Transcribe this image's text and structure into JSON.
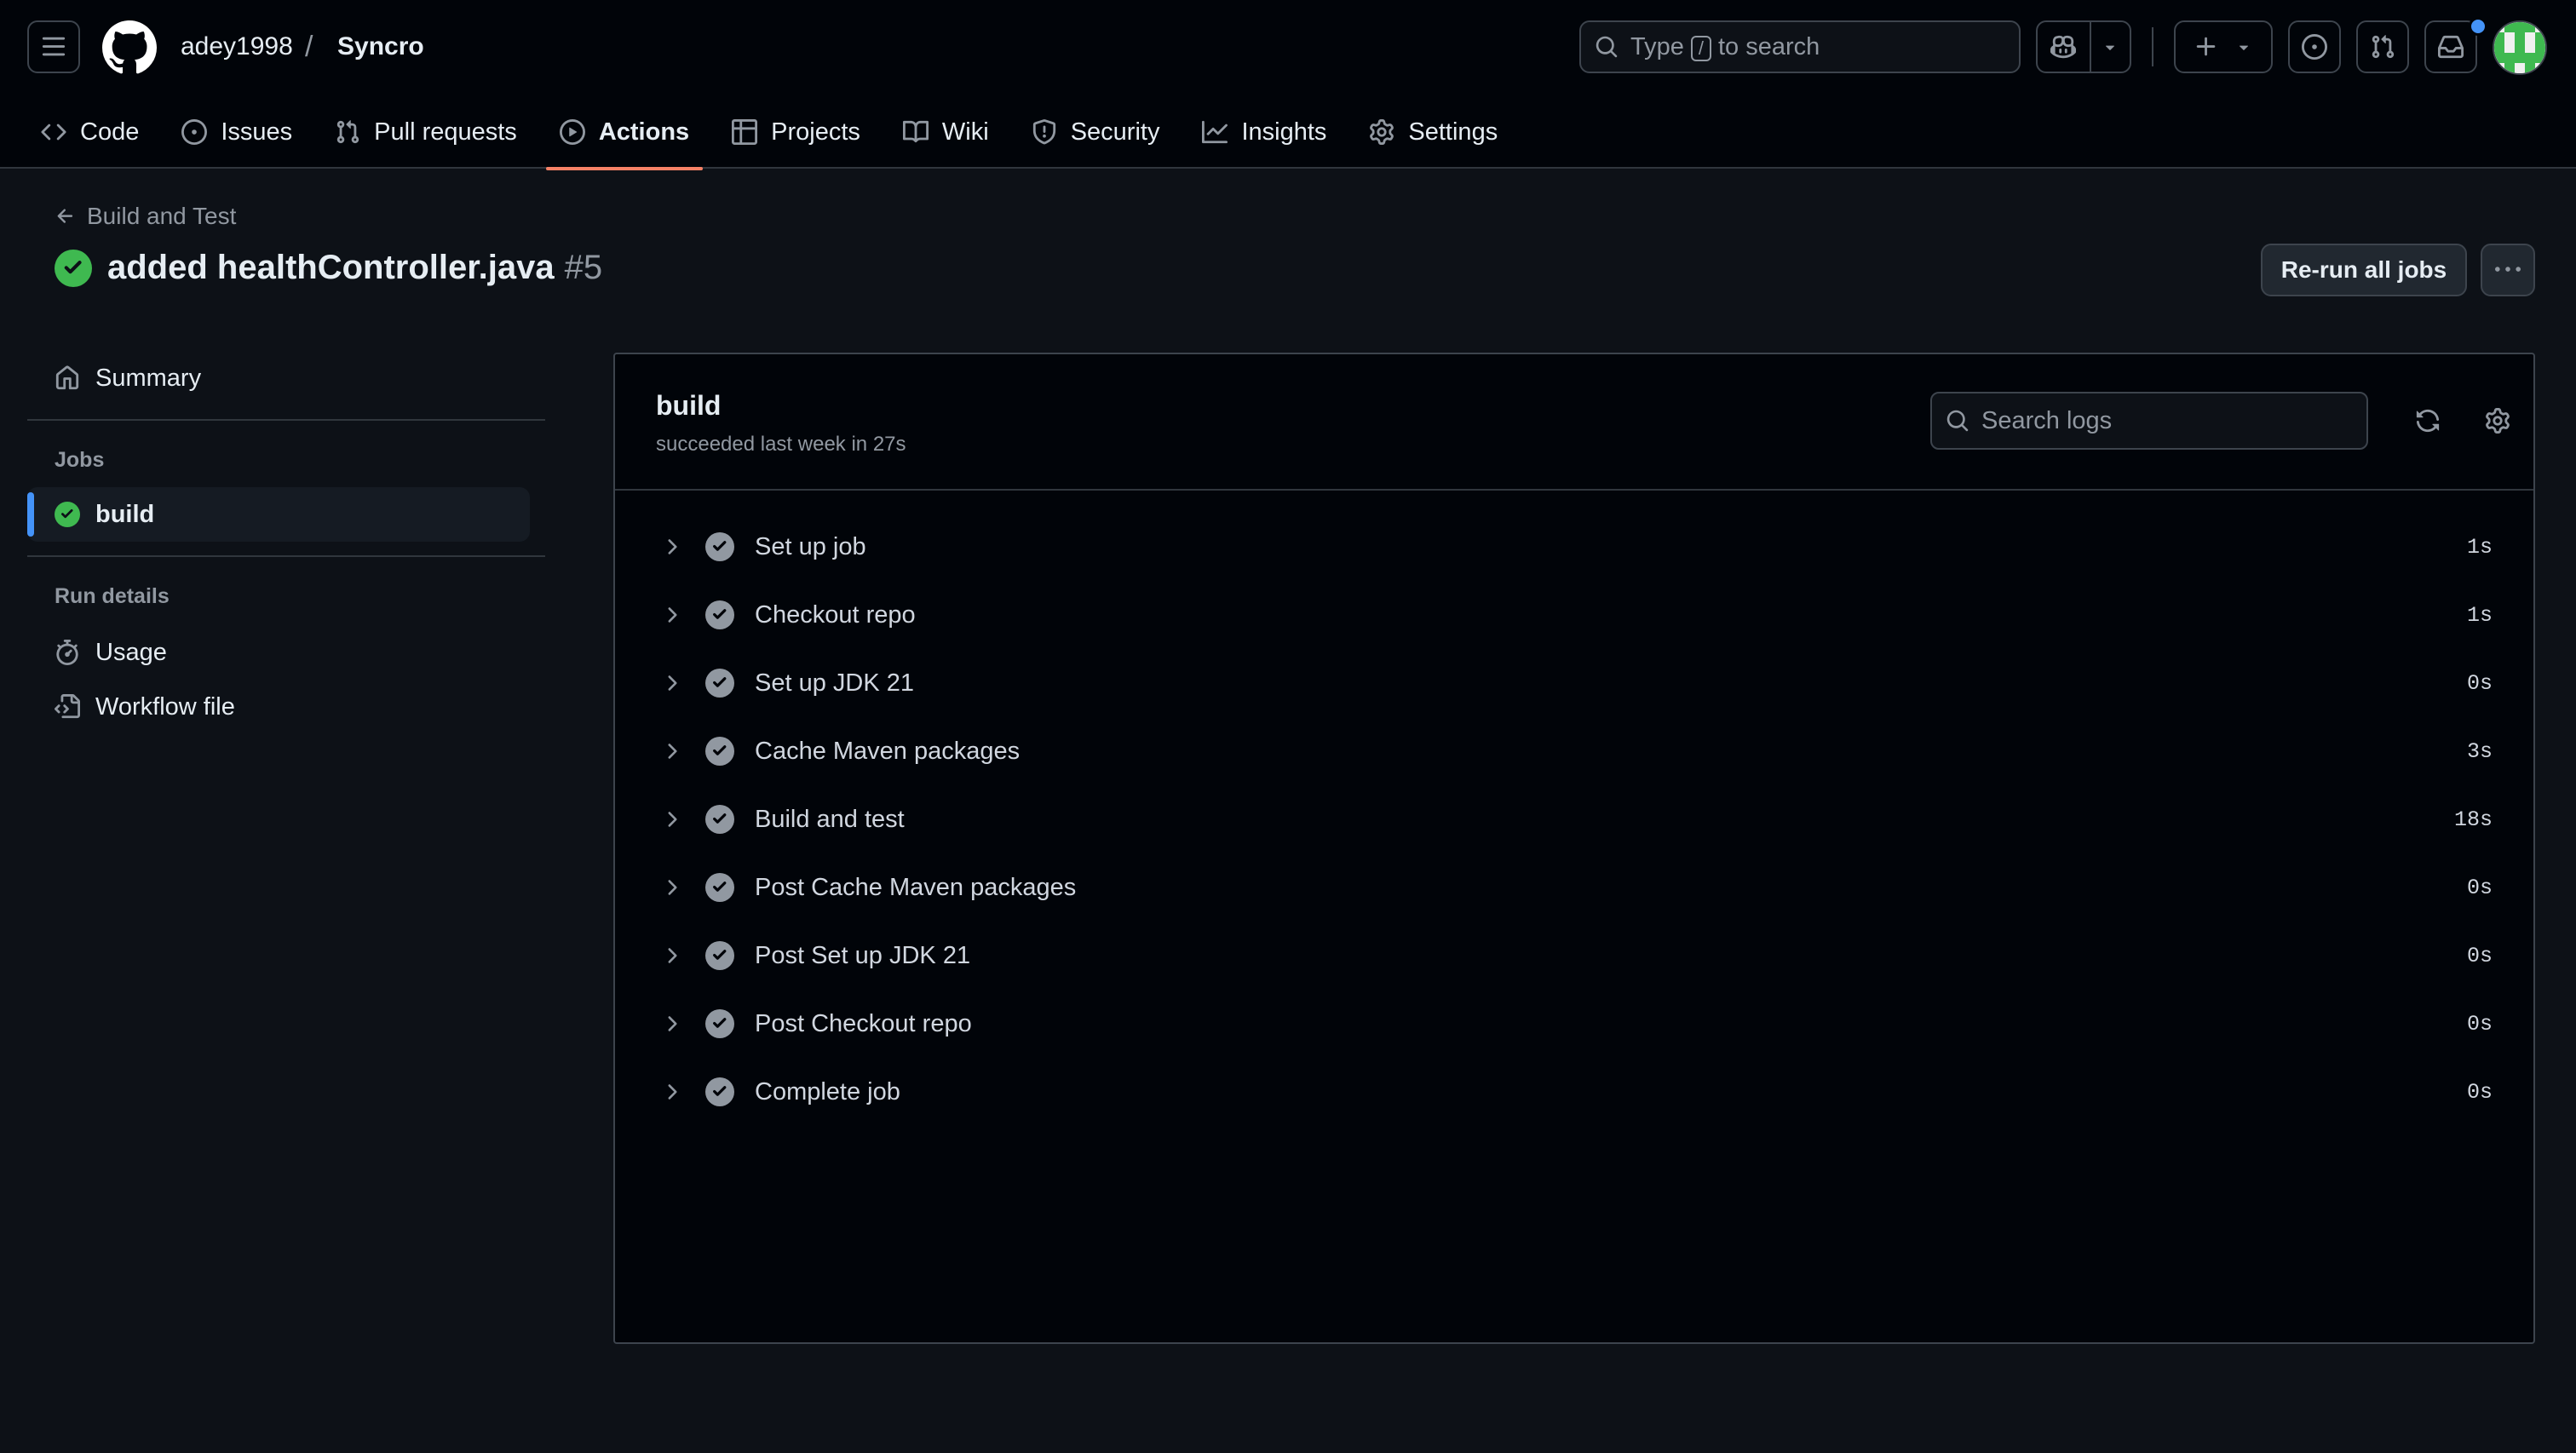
{
  "header": {
    "owner": "adey1998",
    "separator": "/",
    "repo": "Syncro",
    "search": {
      "prefix": "Type",
      "key": "/",
      "suffix": "to search"
    }
  },
  "nav": {
    "tabs": [
      {
        "label": "Code",
        "icon": "code-icon"
      },
      {
        "label": "Issues",
        "icon": "issue-icon"
      },
      {
        "label": "Pull requests",
        "icon": "pull-request-icon"
      },
      {
        "label": "Actions",
        "icon": "play-icon",
        "active": true
      },
      {
        "label": "Projects",
        "icon": "table-icon"
      },
      {
        "label": "Wiki",
        "icon": "book-icon"
      },
      {
        "label": "Security",
        "icon": "shield-icon"
      },
      {
        "label": "Insights",
        "icon": "graph-icon"
      },
      {
        "label": "Settings",
        "icon": "gear-icon"
      }
    ]
  },
  "run": {
    "back_label": "Build and Test",
    "title": "added healthController.java",
    "number": "#5",
    "rerun_label": "Re-run all jobs"
  },
  "sidebar": {
    "summary": "Summary",
    "jobs_heading": "Jobs",
    "job": "build",
    "run_details_heading": "Run details",
    "usage": "Usage",
    "workflow_file": "Workflow file"
  },
  "job": {
    "name": "build",
    "status": "succeeded last week in 27s",
    "search_placeholder": "Search logs",
    "steps": [
      {
        "name": "Set up job",
        "duration": "1s"
      },
      {
        "name": "Checkout repo",
        "duration": "1s"
      },
      {
        "name": "Set up JDK 21",
        "duration": "0s"
      },
      {
        "name": "Cache Maven packages",
        "duration": "3s"
      },
      {
        "name": "Build and test",
        "duration": "18s"
      },
      {
        "name": "Post Cache Maven packages",
        "duration": "0s"
      },
      {
        "name": "Post Set up JDK 21",
        "duration": "0s"
      },
      {
        "name": "Post Checkout repo",
        "duration": "0s"
      },
      {
        "name": "Complete job",
        "duration": "0s"
      }
    ]
  },
  "colors": {
    "success": "#3fb950",
    "accent": "#4493f8",
    "tab_underline": "#f78166"
  }
}
